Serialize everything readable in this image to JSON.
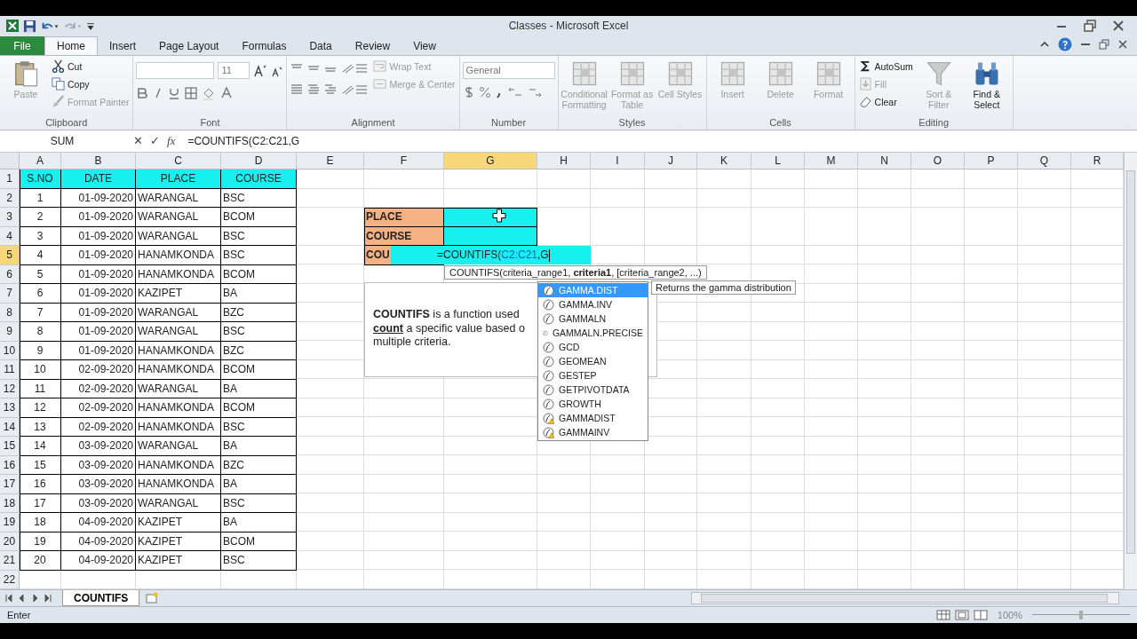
{
  "window": {
    "title": "Classes - Microsoft Excel"
  },
  "ribbon_tabs": [
    {
      "label": "File",
      "kind": "file",
      "selected": false
    },
    {
      "label": "Home",
      "kind": "tab",
      "selected": true
    },
    {
      "label": "Insert",
      "kind": "tab",
      "selected": false
    },
    {
      "label": "Page Layout",
      "kind": "tab",
      "selected": false
    },
    {
      "label": "Formulas",
      "kind": "tab",
      "selected": false
    },
    {
      "label": "Data",
      "kind": "tab",
      "selected": false
    },
    {
      "label": "Review",
      "kind": "tab",
      "selected": false
    },
    {
      "label": "View",
      "kind": "tab",
      "selected": false
    }
  ],
  "ribbon_groups": [
    {
      "label": "Clipboard",
      "kind": "buttons",
      "buttons": [
        {
          "label": "Paste",
          "kind": "large",
          "disabled": true
        },
        {
          "label": "Cut",
          "kind": "small",
          "disabled": false
        },
        {
          "label": "Copy",
          "kind": "small",
          "disabled": false
        },
        {
          "label": "Format Painter",
          "kind": "small",
          "disabled": true
        }
      ]
    },
    {
      "label": "Font",
      "kind": "font",
      "size": "11"
    },
    {
      "label": "Alignment",
      "kind": "alignment",
      "buttons": [
        {
          "label": "Wrap Text",
          "kind": "small",
          "disabled": true
        },
        {
          "label": "Merge & Center",
          "kind": "small",
          "disabled": true
        }
      ]
    },
    {
      "label": "Number",
      "kind": "number",
      "format": "General"
    },
    {
      "label": "Styles",
      "kind": "buttons",
      "buttons": [
        {
          "label": "Conditional Formatting",
          "kind": "large",
          "disabled": true
        },
        {
          "label": "Format as Table",
          "kind": "large",
          "disabled": true
        },
        {
          "label": "Cell Styles",
          "kind": "large",
          "disabled": true
        }
      ]
    },
    {
      "label": "Cells",
      "kind": "buttons",
      "buttons": [
        {
          "label": "Insert",
          "kind": "large",
          "disabled": true
        },
        {
          "label": "Delete",
          "kind": "large",
          "disabled": true
        },
        {
          "label": "Format",
          "kind": "large",
          "disabled": true
        }
      ]
    },
    {
      "label": "Editing",
      "kind": "buttons",
      "buttons": [
        {
          "label": "AutoSum",
          "kind": "small",
          "disabled": false
        },
        {
          "label": "Fill",
          "kind": "small",
          "disabled": true
        },
        {
          "label": "Clear",
          "kind": "small",
          "disabled": false
        },
        {
          "label": "Sort & Filter",
          "kind": "large",
          "disabled": true
        },
        {
          "label": "Find & Select",
          "kind": "large",
          "disabled": false
        }
      ]
    }
  ],
  "formula_bar": {
    "name_box": "SUM",
    "cancel": "✕",
    "enter": "✓",
    "function": "fx",
    "formula": "=COUNTIFS(C2:C21,G"
  },
  "columns": [
    {
      "label": "A",
      "selected": false
    },
    {
      "label": "B",
      "selected": false
    },
    {
      "label": "C",
      "selected": false
    },
    {
      "label": "D",
      "selected": false
    },
    {
      "label": "E",
      "selected": false
    },
    {
      "label": "F",
      "selected": false
    },
    {
      "label": "G",
      "selected": true
    },
    {
      "label": "H",
      "selected": false
    },
    {
      "label": "I",
      "selected": false
    },
    {
      "label": "J",
      "selected": false
    },
    {
      "label": "K",
      "selected": false
    },
    {
      "label": "L",
      "selected": false
    },
    {
      "label": "M",
      "selected": false
    },
    {
      "label": "N",
      "selected": false
    },
    {
      "label": "O",
      "selected": false
    },
    {
      "label": "P",
      "selected": false
    },
    {
      "label": "Q",
      "selected": false
    },
    {
      "label": "R",
      "selected": false
    }
  ],
  "rows": [
    {
      "label": "1",
      "selected": false
    },
    {
      "label": "2",
      "selected": false
    },
    {
      "label": "3",
      "selected": false
    },
    {
      "label": "4",
      "selected": false
    },
    {
      "label": "5",
      "selected": true
    },
    {
      "label": "6",
      "selected": false
    },
    {
      "label": "7",
      "selected": false
    },
    {
      "label": "8",
      "selected": false
    },
    {
      "label": "9",
      "selected": false
    },
    {
      "label": "10",
      "selected": false
    },
    {
      "label": "11",
      "selected": false
    },
    {
      "label": "12",
      "selected": false
    },
    {
      "label": "13",
      "selected": false
    },
    {
      "label": "14",
      "selected": false
    },
    {
      "label": "15",
      "selected": false
    },
    {
      "label": "16",
      "selected": false
    },
    {
      "label": "17",
      "selected": false
    },
    {
      "label": "18",
      "selected": false
    },
    {
      "label": "19",
      "selected": false
    },
    {
      "label": "20",
      "selected": false
    },
    {
      "label": "21",
      "selected": false
    },
    {
      "label": "22",
      "selected": false
    }
  ],
  "data_table": {
    "columns": [
      "S.NO",
      "DATE",
      "PLACE",
      "COURSE"
    ],
    "rows": [
      [
        "1",
        "01-09-2020",
        "WARANGAL",
        "BSC"
      ],
      [
        "2",
        "01-09-2020",
        "WARANGAL",
        "BCOM"
      ],
      [
        "3",
        "01-09-2020",
        "WARANGAL",
        "BSC"
      ],
      [
        "4",
        "01-09-2020",
        "HANAMKONDA",
        "BSC"
      ],
      [
        "5",
        "01-09-2020",
        "HANAMKONDA",
        "BCOM"
      ],
      [
        "6",
        "01-09-2020",
        "KAZIPET",
        "BA"
      ],
      [
        "7",
        "01-09-2020",
        "WARANGAL",
        "BZC"
      ],
      [
        "8",
        "01-09-2020",
        "WARANGAL",
        "BSC"
      ],
      [
        "9",
        "01-09-2020",
        "HANAMKONDA",
        "BZC"
      ],
      [
        "10",
        "02-09-2020",
        "HANAMKONDA",
        "BCOM"
      ],
      [
        "11",
        "02-09-2020",
        "WARANGAL",
        "BA"
      ],
      [
        "12",
        "02-09-2020",
        "HANAMKONDA",
        "BCOM"
      ],
      [
        "13",
        "02-09-2020",
        "HANAMKONDA",
        "BSC"
      ],
      [
        "14",
        "03-09-2020",
        "WARANGAL",
        "BA"
      ],
      [
        "15",
        "03-09-2020",
        "HANAMKONDA",
        "BZC"
      ],
      [
        "16",
        "03-09-2020",
        "HANAMKONDA",
        "BA"
      ],
      [
        "17",
        "03-09-2020",
        "WARANGAL",
        "BSC"
      ],
      [
        "18",
        "04-09-2020",
        "KAZIPET",
        "BA"
      ],
      [
        "19",
        "04-09-2020",
        "KAZIPET",
        "BCOM"
      ],
      [
        "20",
        "04-09-2020",
        "KAZIPET",
        "BSC"
      ]
    ]
  },
  "criteria": [
    {
      "label": "PLACE"
    },
    {
      "label": "COURSE"
    },
    {
      "label": "COU"
    }
  ],
  "cell_editor": {
    "parts": [
      {
        "text": "=COUNTIFS(",
        "kind": "text"
      },
      {
        "text": "C2:C21",
        "kind": "reference"
      },
      {
        "text": ",G",
        "kind": "text"
      }
    ]
  },
  "syntax_tooltip": "COUNTIFS(criteria_range1, **criteria1**, [criteria_range2, ...)",
  "text_box": {
    "lines": [
      [
        {
          "text": "COUNTIFS",
          "kind": "term"
        },
        {
          "text": " is a function used",
          "kind": "plain"
        }
      ],
      [
        {
          "text": "count",
          "kind": "keyword"
        },
        {
          "text": " a specific value based o",
          "kind": "plain"
        }
      ],
      [
        {
          "text": "multiple criteria.",
          "kind": "plain"
        }
      ]
    ]
  },
  "autocomplete": {
    "items": [
      {
        "label": "GAMMA.DIST",
        "kind": "function",
        "selected": true
      },
      {
        "label": "GAMMA.INV",
        "kind": "function",
        "selected": false
      },
      {
        "label": "GAMMALN",
        "kind": "function",
        "selected": false
      },
      {
        "label": "GAMMALN.PRECISE",
        "kind": "function",
        "selected": false
      },
      {
        "label": "GCD",
        "kind": "function",
        "selected": false
      },
      {
        "label": "GEOMEAN",
        "kind": "function",
        "selected": false
      },
      {
        "label": "GESTEP",
        "kind": "function",
        "selected": false
      },
      {
        "label": "GETPIVOTDATA",
        "kind": "function",
        "selected": false
      },
      {
        "label": "GROWTH",
        "kind": "function",
        "selected": false
      },
      {
        "label": "GAMMADIST",
        "kind": "compatibility",
        "selected": false
      },
      {
        "label": "GAMMAINV",
        "kind": "compatibility",
        "selected": false
      }
    ],
    "description": "Returns the gamma distribution"
  },
  "sheet_tabs": [
    {
      "label": "COUNTIFS",
      "selected": true
    }
  ],
  "status_bar": {
    "mode": "Enter",
    "zoom": "100%",
    "zoom_slider": {
      "level": 0.5
    }
  }
}
